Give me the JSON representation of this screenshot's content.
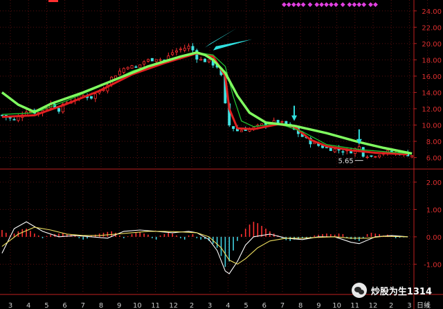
{
  "chart_data": [
    {
      "type": "candlestick",
      "panel": "price",
      "ylim": [
        4.6,
        25.0
      ],
      "y_ticks": [
        6,
        8,
        10,
        12,
        14,
        16,
        18,
        20,
        22,
        24
      ],
      "y_tick_labels": [
        "6.00",
        "8.00",
        "10.00",
        "12.00",
        "14.00",
        "16.00",
        "18.00",
        "20.00",
        "22.00",
        "24.00"
      ],
      "x_ticks": [
        "3",
        "4",
        "5",
        "6",
        "7",
        "8",
        "9",
        "10",
        "11",
        "12",
        "2",
        "3",
        "4",
        "5",
        "6",
        "7",
        "8",
        "9",
        "10",
        "11",
        "12",
        "2",
        "3",
        "4"
      ],
      "x_axis_label": "日线",
      "close_path": [
        [
          0,
          11.2
        ],
        [
          3,
          10.6
        ],
        [
          6,
          11.8
        ],
        [
          9,
          11.5
        ],
        [
          12,
          12.6
        ],
        [
          14,
          11.9
        ],
        [
          16,
          12.8
        ],
        [
          18,
          13.2
        ],
        [
          20,
          13.6
        ],
        [
          22,
          13.4
        ],
        [
          25,
          14.5
        ],
        [
          27,
          15.8
        ],
        [
          29,
          16.6
        ],
        [
          31,
          17.3
        ],
        [
          33,
          17.0
        ],
        [
          35,
          17.8
        ],
        [
          38,
          18.2
        ],
        [
          40,
          17.9
        ],
        [
          42,
          18.9
        ],
        [
          44,
          19.3
        ],
        [
          46,
          19.6
        ],
        [
          47,
          19.2
        ],
        [
          48,
          18.3
        ],
        [
          49,
          18.0
        ],
        [
          51,
          17.8
        ],
        [
          53,
          17.2
        ],
        [
          54,
          16.0
        ],
        [
          55,
          12.5
        ],
        [
          56,
          10.0
        ],
        [
          58,
          9.3
        ],
        [
          60,
          9.5
        ],
        [
          62,
          9.6
        ],
        [
          64,
          10.0
        ],
        [
          66,
          10.3
        ],
        [
          68,
          10.4
        ],
        [
          70,
          10.0
        ],
        [
          72,
          9.4
        ],
        [
          74,
          8.6
        ],
        [
          76,
          7.9
        ],
        [
          78,
          7.5
        ],
        [
          80,
          7.2
        ],
        [
          82,
          7.0
        ],
        [
          84,
          6.9
        ],
        [
          86,
          6.8
        ],
        [
          88,
          7.3
        ],
        [
          89,
          6.4
        ],
        [
          91,
          6.2
        ],
        [
          93,
          6.5
        ],
        [
          95,
          6.7
        ],
        [
          97,
          6.6
        ],
        [
          99,
          6.5
        ],
        [
          101,
          6.3
        ]
      ],
      "series": [
        {
          "name": "",
          "color": "#e02020",
          "values": [
            [
              0,
              11.0
            ],
            [
              8,
              11.2
            ],
            [
              16,
              12.6
            ],
            [
              24,
              14.2
            ],
            [
              32,
              16.2
            ],
            [
              40,
              17.6
            ],
            [
              48,
              18.8
            ],
            [
              52,
              18.4
            ],
            [
              55,
              16.0
            ],
            [
              56,
              12.0
            ],
            [
              58,
              9.6
            ],
            [
              62,
              9.5
            ],
            [
              68,
              10.1
            ],
            [
              72,
              9.8
            ],
            [
              76,
              8.2
            ],
            [
              80,
              7.4
            ],
            [
              86,
              6.9
            ],
            [
              92,
              6.6
            ],
            [
              100,
              6.4
            ]
          ]
        },
        {
          "name": "",
          "color": "#20c030",
          "values": [
            [
              0,
              11.3
            ],
            [
              8,
              11.5
            ],
            [
              16,
              13.0
            ],
            [
              24,
              14.7
            ],
            [
              32,
              16.6
            ],
            [
              40,
              17.9
            ],
            [
              48,
              18.9
            ],
            [
              52,
              18.6
            ],
            [
              55,
              17.2
            ],
            [
              57,
              13.5
            ],
            [
              59,
              10.5
            ],
            [
              62,
              9.8
            ],
            [
              68,
              10.2
            ],
            [
              74,
              9.2
            ],
            [
              80,
              7.6
            ],
            [
              88,
              7.0
            ],
            [
              100,
              6.5
            ]
          ]
        },
        {
          "name": "",
          "color": "#80ff60",
          "values": [
            [
              0,
              14.0
            ],
            [
              4,
              12.5
            ],
            [
              8,
              11.6
            ],
            [
              12,
              12.6
            ],
            [
              20,
              14.0
            ],
            [
              28,
              15.6
            ],
            [
              36,
              17.2
            ],
            [
              44,
              18.4
            ],
            [
              48,
              18.9
            ],
            [
              50,
              18.6
            ],
            [
              52,
              18.0
            ],
            [
              55,
              16.4
            ],
            [
              58,
              13.6
            ],
            [
              61,
              11.5
            ],
            [
              65,
              10.3
            ],
            [
              72,
              9.9
            ],
            [
              80,
              9.0
            ],
            [
              88,
              7.9
            ],
            [
              94,
              7.2
            ],
            [
              101,
              6.5
            ]
          ]
        }
      ],
      "annotations": [
        {
          "text": "5.65",
          "x": 89,
          "y": 5.65,
          "type": "low-marker"
        },
        {
          "text": "",
          "x": 51,
          "y": 19.5,
          "type": "arrow-head-cyan"
        },
        {
          "text": "",
          "x": 72,
          "y": 10.5,
          "type": "arrow-down-cyan"
        },
        {
          "text": "",
          "x": 88,
          "y": 7.6,
          "type": "arrow-down-cyan"
        }
      ]
    },
    {
      "type": "bar",
      "panel": "MACD",
      "ylim": [
        -1.6,
        2.2
      ],
      "y_ticks": [
        -1.0,
        0,
        1.0,
        2.0
      ],
      "y_tick_labels": [
        "-1.00",
        "0.00",
        "1.00",
        "2.00"
      ],
      "histogram": [
        [
          0,
          0.25
        ],
        [
          1,
          0.15
        ],
        [
          2,
          0.05
        ],
        [
          3,
          0.12
        ],
        [
          4,
          0.2
        ],
        [
          5,
          0.28
        ],
        [
          6,
          0.3
        ],
        [
          7,
          0.22
        ],
        [
          8,
          0.12
        ],
        [
          9,
          0.05
        ],
        [
          10,
          -0.05
        ],
        [
          11,
          0.03
        ],
        [
          12,
          0.08
        ],
        [
          13,
          0.1
        ],
        [
          14,
          0.12
        ],
        [
          15,
          0.14
        ],
        [
          16,
          0.1
        ],
        [
          17,
          0.08
        ],
        [
          18,
          0.05
        ],
        [
          19,
          -0.05
        ],
        [
          20,
          -0.1
        ],
        [
          21,
          -0.06
        ],
        [
          22,
          0.05
        ],
        [
          23,
          0.08
        ],
        [
          24,
          0.12
        ],
        [
          25,
          0.15
        ],
        [
          26,
          0.18
        ],
        [
          27,
          0.2
        ],
        [
          28,
          0.15
        ],
        [
          29,
          0.05
        ],
        [
          30,
          -0.05
        ],
        [
          31,
          0.02
        ],
        [
          32,
          0.1
        ],
        [
          33,
          0.15
        ],
        [
          34,
          0.18
        ],
        [
          35,
          0.12
        ],
        [
          36,
          0.08
        ],
        [
          37,
          -0.05
        ],
        [
          38,
          -0.1
        ],
        [
          39,
          0.05
        ],
        [
          40,
          0.1
        ],
        [
          41,
          0.15
        ],
        [
          42,
          0.12
        ],
        [
          43,
          0.05
        ],
        [
          44,
          -0.05
        ],
        [
          45,
          -0.1
        ],
        [
          46,
          0.05
        ],
        [
          47,
          0.1
        ],
        [
          48,
          -0.05
        ],
        [
          49,
          -0.1
        ],
        [
          50,
          -0.08
        ],
        [
          51,
          -0.15
        ],
        [
          52,
          -0.25
        ],
        [
          53,
          -0.4
        ],
        [
          54,
          -0.7
        ],
        [
          55,
          -1.1
        ],
        [
          56,
          -0.9
        ],
        [
          57,
          -0.5
        ],
        [
          58,
          -0.15
        ],
        [
          59,
          0.1
        ],
        [
          60,
          0.3
        ],
        [
          61,
          0.45
        ],
        [
          62,
          0.55
        ],
        [
          63,
          0.5
        ],
        [
          64,
          0.4
        ],
        [
          65,
          0.3
        ],
        [
          66,
          0.2
        ],
        [
          67,
          0.12
        ],
        [
          68,
          0.05
        ],
        [
          69,
          -0.05
        ],
        [
          70,
          -0.12
        ],
        [
          71,
          -0.15
        ],
        [
          72,
          -0.1
        ],
        [
          73,
          -0.08
        ],
        [
          74,
          -0.05
        ],
        [
          75,
          -0.08
        ],
        [
          76,
          -0.05
        ],
        [
          77,
          0.05
        ],
        [
          78,
          0.08
        ],
        [
          79,
          0.1
        ],
        [
          80,
          0.12
        ],
        [
          81,
          0.1
        ],
        [
          82,
          0.08
        ],
        [
          83,
          0.12
        ],
        [
          84,
          0.1
        ],
        [
          85,
          -0.05
        ],
        [
          86,
          -0.08
        ],
        [
          87,
          -0.1
        ],
        [
          88,
          -0.15
        ],
        [
          89,
          -0.05
        ],
        [
          90,
          0.1
        ],
        [
          91,
          0.15
        ],
        [
          92,
          0.12
        ],
        [
          93,
          0.1
        ],
        [
          94,
          0.05
        ],
        [
          95,
          0.08
        ],
        [
          96,
          0.05
        ],
        [
          97,
          -0.05
        ],
        [
          98,
          -0.03
        ],
        [
          99,
          -0.02
        ]
      ],
      "series": [
        {
          "name": "",
          "color": "#ffffff",
          "values": [
            [
              0,
              -0.6
            ],
            [
              3,
              0.3
            ],
            [
              6,
              0.55
            ],
            [
              10,
              0.2
            ],
            [
              14,
              0.0
            ],
            [
              18,
              0.05
            ],
            [
              22,
              0.0
            ],
            [
              26,
              -0.05
            ],
            [
              30,
              0.2
            ],
            [
              34,
              0.25
            ],
            [
              38,
              0.2
            ],
            [
              42,
              0.15
            ],
            [
              46,
              0.2
            ],
            [
              48,
              0.15
            ],
            [
              51,
              -0.1
            ],
            [
              53,
              -0.5
            ],
            [
              55,
              -1.25
            ],
            [
              56,
              -1.35
            ],
            [
              58,
              -0.9
            ],
            [
              60,
              -0.3
            ],
            [
              62,
              0.0
            ],
            [
              66,
              0.1
            ],
            [
              70,
              -0.05
            ],
            [
              74,
              -0.1
            ],
            [
              78,
              0.0
            ],
            [
              82,
              0.0
            ],
            [
              86,
              -0.2
            ],
            [
              88,
              -0.25
            ],
            [
              92,
              0.0
            ],
            [
              96,
              0.05
            ],
            [
              100,
              0.0
            ]
          ]
        },
        {
          "name": "",
          "color": "#f0e060",
          "values": [
            [
              0,
              -0.35
            ],
            [
              4,
              0.1
            ],
            [
              8,
              0.35
            ],
            [
              12,
              0.25
            ],
            [
              16,
              0.1
            ],
            [
              20,
              0.05
            ],
            [
              24,
              0.05
            ],
            [
              28,
              0.1
            ],
            [
              32,
              0.15
            ],
            [
              36,
              0.2
            ],
            [
              40,
              0.2
            ],
            [
              44,
              0.18
            ],
            [
              48,
              0.15
            ],
            [
              51,
              0.0
            ],
            [
              54,
              -0.4
            ],
            [
              56,
              -0.85
            ],
            [
              58,
              -1.0
            ],
            [
              60,
              -0.8
            ],
            [
              63,
              -0.4
            ],
            [
              66,
              -0.15
            ],
            [
              70,
              -0.05
            ],
            [
              74,
              -0.05
            ],
            [
              78,
              -0.02
            ],
            [
              82,
              0.0
            ],
            [
              86,
              -0.05
            ],
            [
              90,
              -0.05
            ],
            [
              94,
              0.02
            ],
            [
              100,
              0.0
            ]
          ]
        }
      ]
    }
  ],
  "top_markers": "◆◆◆◆◆  ◆   ◆◆◆◆◆  ◆    ◆◆◆◆  ◆◆",
  "watermark": {
    "text": "炒股为生1314",
    "icon": "wechat-icon"
  }
}
